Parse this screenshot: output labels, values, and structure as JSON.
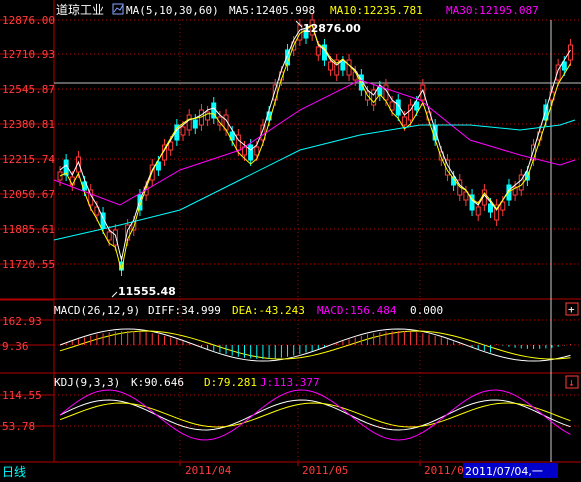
{
  "header": {
    "index_name": "道琼工业",
    "ma_label": "MA(5,10,30,60)",
    "ma5": "MA5:12405.998",
    "ma10": "MA10:12235.781",
    "ma30": "MA30:12195.087"
  },
  "price_axis": {
    "ticks": [
      "12876.00",
      "12710.93",
      "12545.87",
      "12380.81",
      "12215.74",
      "12050.67",
      "11885.61",
      "11720.55"
    ]
  },
  "annotations": {
    "high": "12876.00",
    "low": "11555.48"
  },
  "macd": {
    "label": "MACD(26,12,9)",
    "diff": "DIFF:34.999",
    "dea": "DEA:-43.243",
    "macd": "MACD:156.484",
    "extra": "0.000",
    "ticks": [
      "162.93",
      "9.36"
    ]
  },
  "kdj": {
    "label": "KDJ(9,3,3)",
    "k": "K:90.646",
    "d": "D:79.281",
    "j": "J:113.377",
    "ticks": [
      "114.55",
      "53.78"
    ]
  },
  "footer": {
    "period": "日线",
    "dates": [
      "2011/04",
      "2011/05",
      "2011/06"
    ],
    "cursor_date": "2011/07/04,一"
  },
  "colors": {
    "up": "#ff3c3c",
    "down": "#00ffff",
    "ma5": "#ffffff",
    "ma10": "#ffff00",
    "ma30": "#ff00ff",
    "ma60": "#00ff00",
    "grid": "#b40000",
    "cursor_bg": "#0000c8"
  }
}
